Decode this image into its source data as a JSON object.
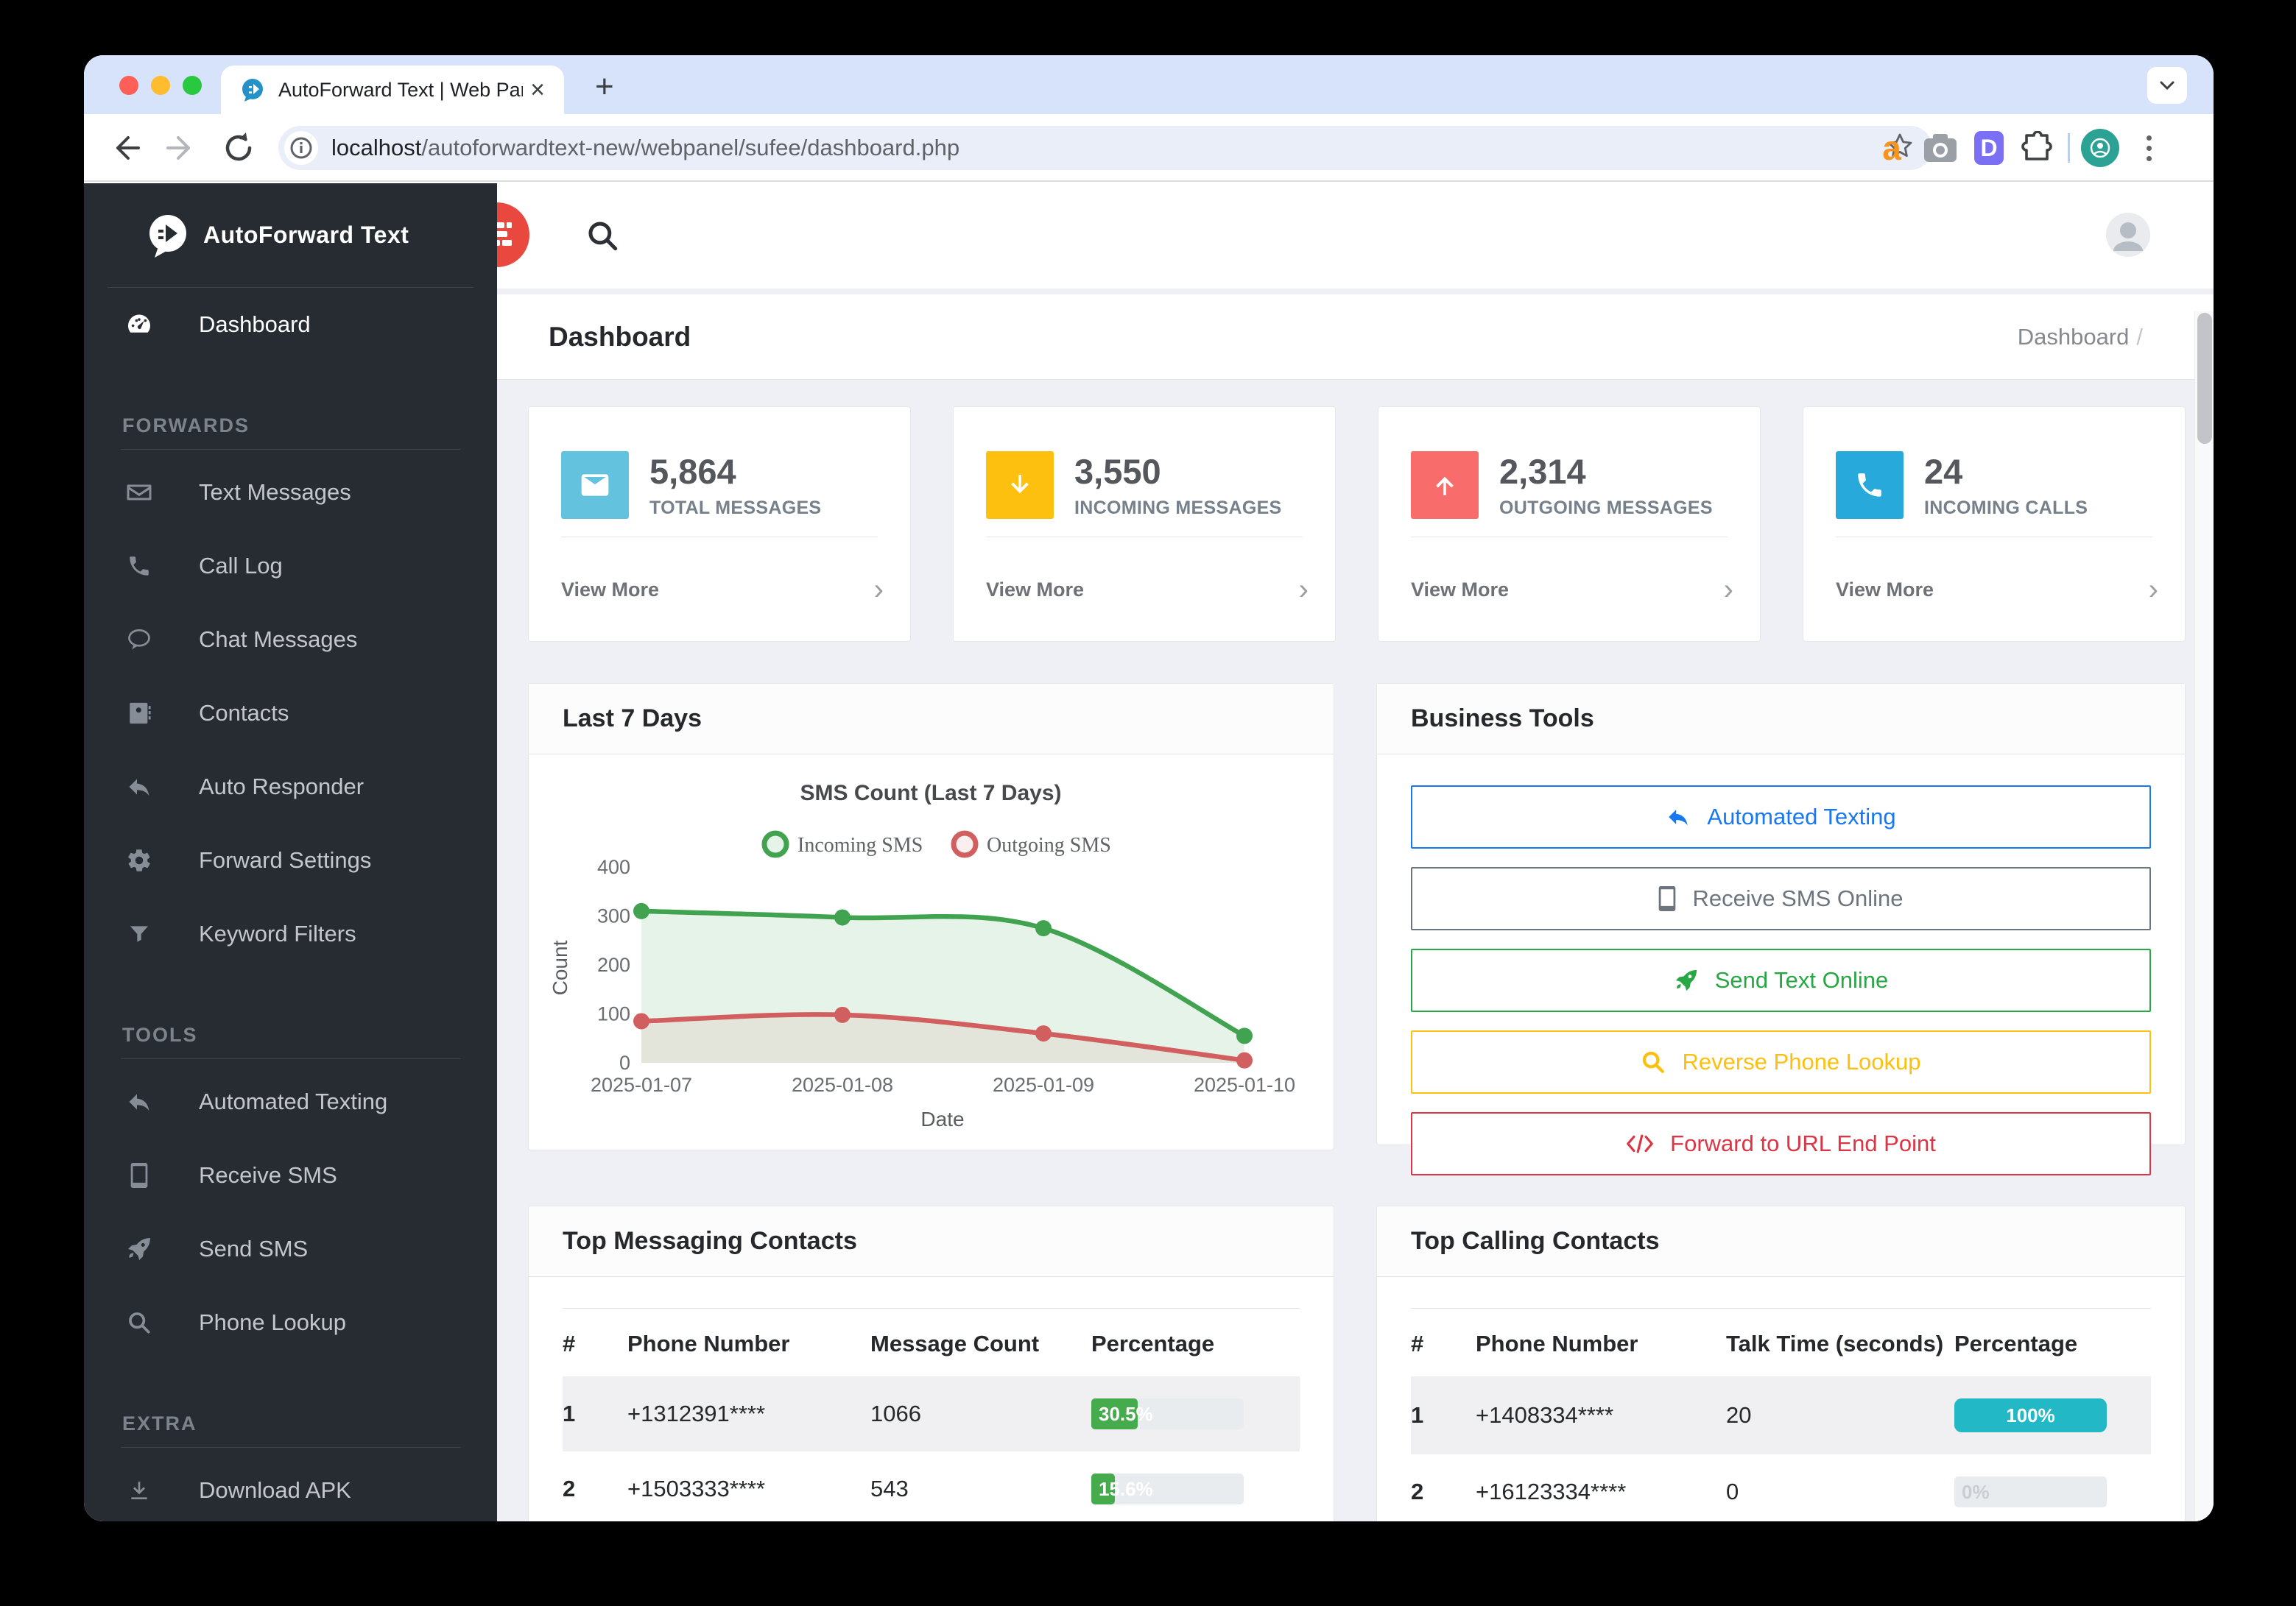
{
  "browser": {
    "tab_title": "AutoForward Text | Web Panel",
    "close_tab": "×",
    "new_tab": "+",
    "url_host": "localhost",
    "url_path": "/autoforwardtext-new/webpanel/sufee/dashboard.php",
    "ext_a": "a",
    "ext_d": "D",
    "traffic_colors": [
      "#ff5f57",
      "#febc2e",
      "#28c840"
    ]
  },
  "header": {
    "page_title": "Dashboard",
    "breadcrumb": "Dashboard",
    "breadcrumb_sep": "/"
  },
  "sidebar": {
    "logo": "AutoForward Text",
    "dashboard": "Dashboard",
    "groups": [
      {
        "title": "FORWARDS",
        "items": [
          "Text Messages",
          "Call Log",
          "Chat Messages",
          "Contacts",
          "Auto Responder",
          "Forward Settings",
          "Keyword Filters"
        ]
      },
      {
        "title": "TOOLS",
        "items": [
          "Automated Texting",
          "Receive SMS",
          "Send SMS",
          "Phone Lookup"
        ]
      },
      {
        "title": "EXTRA",
        "items": [
          "Download APK"
        ]
      }
    ]
  },
  "stats": {
    "view_more": "View More",
    "chevron": "›",
    "cards": [
      {
        "value": "5,864",
        "label": "TOTAL MESSAGES",
        "color": "#63c2de",
        "icon": "envelope-icon"
      },
      {
        "value": "3,550",
        "label": "INCOMING MESSAGES",
        "color": "#fdc00f",
        "icon": "arrow-down-icon"
      },
      {
        "value": "2,314",
        "label": "OUTGOING MESSAGES",
        "color": "#f86c6b",
        "icon": "arrow-up-icon"
      },
      {
        "value": "24",
        "label": "INCOMING CALLS",
        "color": "#27a9dc",
        "icon": "phone-icon"
      }
    ]
  },
  "chart_data": {
    "type": "line",
    "card_title": "Last 7 Days",
    "title": "SMS Count (Last 7 Days)",
    "x": [
      "2025-01-07",
      "2025-01-08",
      "2025-01-09",
      "2025-01-10"
    ],
    "series": [
      {
        "name": "Incoming SMS",
        "color": "#41a350",
        "fill": "rgba(65,163,80,0.13)",
        "values": [
          310,
          297,
          275,
          55
        ]
      },
      {
        "name": "Outgoing SMS",
        "color": "#d25f5f",
        "fill": "rgba(210,95,95,0.10)",
        "values": [
          85,
          98,
          60,
          5
        ]
      }
    ],
    "xlabel": "Date",
    "ylabel": "Count",
    "yticks": [
      0,
      100,
      200,
      300,
      400
    ],
    "ylim": [
      0,
      400
    ],
    "legend_position": "top",
    "grid": false
  },
  "business_tools": {
    "title": "Business Tools",
    "buttons": [
      {
        "label": "Automated Texting",
        "color": "#1778f2",
        "icon": "reply-icon"
      },
      {
        "label": "Receive SMS Online",
        "color": "#6c757d",
        "icon": "mobile-icon"
      },
      {
        "label": "Send Text Online",
        "color": "#28a745",
        "icon": "rocket-icon"
      },
      {
        "label": "Reverse Phone Lookup",
        "color": "#fdc00f",
        "icon": "search-icon"
      },
      {
        "label": "Forward to URL End Point",
        "color": "#dc3545",
        "icon": "code-icon"
      }
    ]
  },
  "messaging_table": {
    "title": "Top Messaging Contacts",
    "headers": [
      "#",
      "Phone Number",
      "Message Count",
      "Percentage"
    ],
    "bar_color": "#46ab4d",
    "rows": [
      {
        "rank": "1",
        "phone": "+1312391****",
        "count": "1066",
        "pct": 30.5,
        "pct_label": "30.5%"
      },
      {
        "rank": "2",
        "phone": "+1503333****",
        "count": "543",
        "pct": 15.6,
        "pct_label": "15.6%"
      }
    ]
  },
  "calling_table": {
    "title": "Top Calling Contacts",
    "headers": [
      "#",
      "Phone Number",
      "Talk Time (seconds)",
      "Percentage"
    ],
    "bar_color": "#22b8c6",
    "rows": [
      {
        "rank": "1",
        "phone": "+1408334****",
        "talk": "20",
        "pct": 100,
        "pct_label": "100%"
      },
      {
        "rank": "2",
        "phone": "+16123334****",
        "talk": "0",
        "pct": 0,
        "pct_label": "0%"
      }
    ]
  }
}
